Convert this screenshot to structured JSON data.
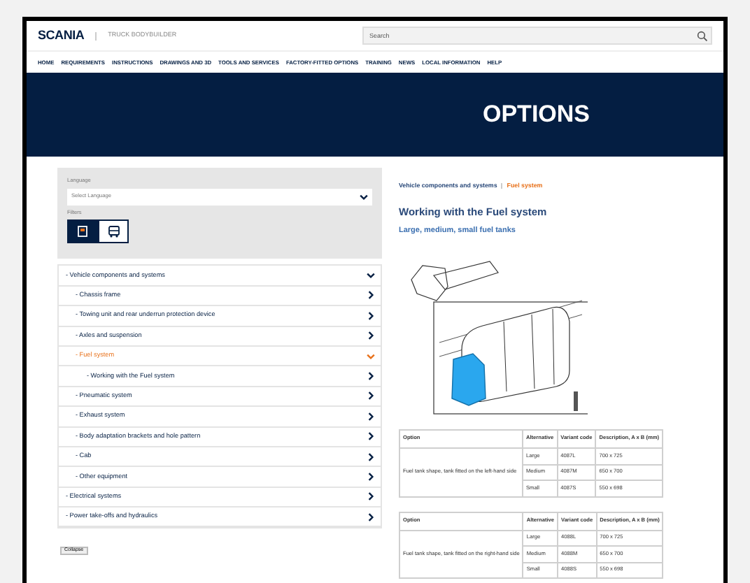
{
  "header": {
    "logo": "SCANIA",
    "subtitle": "TRUCK BODYBUILDER",
    "search": {
      "placeholder": "Search"
    }
  },
  "nav": [
    "HOME",
    "REQUIREMENTS",
    "INSTRUCTIONS",
    "DRAWINGS AND 3D",
    "TOOLS AND SERVICES",
    "FACTORY-FITTED OPTIONS",
    "TRAINING",
    "NEWS",
    "LOCAL INFORMATION",
    "HELP"
  ],
  "banner": {
    "title": "OPTIONS"
  },
  "sidebar": {
    "language_label": "Language",
    "language": {
      "placeholder": "Select Language"
    },
    "filters_label": "Filters",
    "filters": [
      {
        "kind": "truck",
        "selected": true
      },
      {
        "kind": "bus",
        "selected": false
      }
    ],
    "tree": [
      {
        "label": "- Vehicle components and systems",
        "expanded": true,
        "selected": false,
        "children": [
          {
            "label": "- Chassis frame",
            "expanded": false,
            "selected": false
          },
          {
            "label": "- Towing unit and rear underrun protection device",
            "expanded": false,
            "selected": false
          },
          {
            "label": "- Axles and suspension",
            "expanded": false,
            "selected": false
          },
          {
            "label": "- Fuel system",
            "expanded": true,
            "selected": true,
            "children": [
              {
                "label": "- Working with the Fuel system",
                "expanded": false,
                "selected": false
              }
            ]
          },
          {
            "label": "- Pneumatic system",
            "expanded": false,
            "selected": false
          },
          {
            "label": "- Exhaust system",
            "expanded": false,
            "selected": false
          },
          {
            "label": "- Body adaptation brackets and hole pattern",
            "expanded": false,
            "selected": false
          },
          {
            "label": "- Cab",
            "expanded": false,
            "selected": false
          },
          {
            "label": "- Other equipment",
            "expanded": false,
            "selected": false
          }
        ]
      },
      {
        "label": "- Electrical systems",
        "expanded": false,
        "selected": false
      },
      {
        "label": "- Power take-offs and hydraulics",
        "expanded": false,
        "selected": false
      }
    ],
    "collapse_button": "Collapse"
  },
  "content": {
    "breadcrumb": [
      "Vehicle components and systems",
      "Fuel system"
    ],
    "title": "Working with the Fuel system",
    "subtitle": "Large, medium, small fuel tanks",
    "tables": [
      {
        "columns": [
          "Option",
          "Alternative",
          "Variant code",
          "Description, A x B (mm)"
        ],
        "rows": [
          [
            {
              "text": "Fuel tank shape, tank fitted on the left-hand side",
              "rowspan": 3
            },
            "Large",
            "4087L",
            "700 x 725"
          ],
          [
            "Medium",
            "4087M",
            "650 x 700"
          ],
          [
            "Small",
            "4087S",
            "550 x 698"
          ]
        ]
      },
      {
        "columns": [
          "Option",
          "Alternative",
          "Variant code",
          "Description, A x B (mm)"
        ],
        "rows": [
          [
            {
              "text": "Fuel tank shape, tank fitted on the right-hand side",
              "rowspan": 3
            },
            "Large",
            "4088L",
            "700 x 725"
          ],
          [
            "Medium",
            "4088M",
            "650 x 700"
          ],
          [
            "Small",
            "4088S",
            "550 x 698"
          ]
        ]
      }
    ]
  }
}
